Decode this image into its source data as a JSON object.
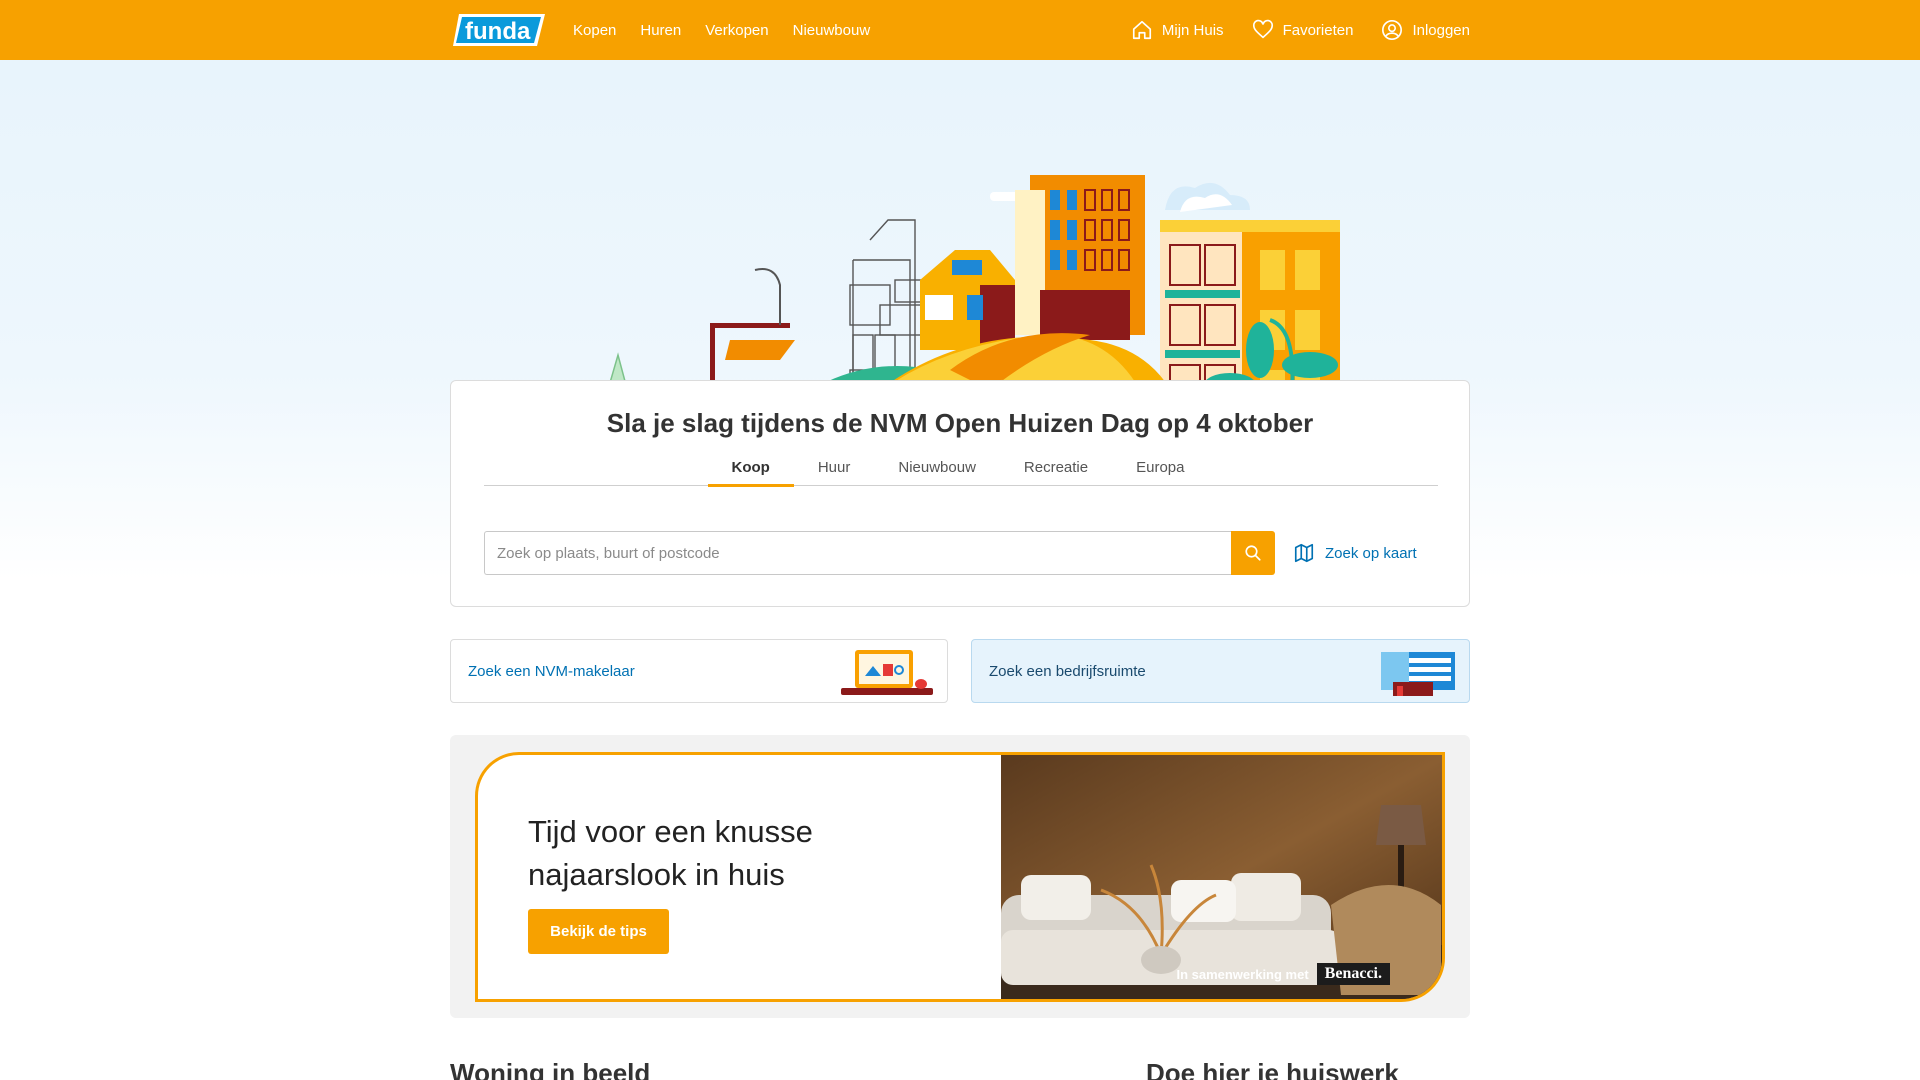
{
  "colors": {
    "brand": "#f7a100",
    "link": "#0071b3",
    "text": "#333333"
  },
  "header": {
    "logo_text": "funda",
    "nav": [
      {
        "label": "Kopen"
      },
      {
        "label": "Huren"
      },
      {
        "label": "Verkopen"
      },
      {
        "label": "Nieuwbouw"
      }
    ],
    "right_nav": [
      {
        "label": "Mijn Huis",
        "icon": "home-icon"
      },
      {
        "label": "Favorieten",
        "icon": "heart-icon"
      },
      {
        "label": "Inloggen",
        "icon": "user-icon"
      }
    ]
  },
  "search": {
    "title": "Sla je slag tijdens de NVM Open Huizen Dag op 4 oktober",
    "tabs": [
      {
        "label": "Koop",
        "active": true
      },
      {
        "label": "Huur",
        "active": false
      },
      {
        "label": "Nieuwbouw",
        "active": false
      },
      {
        "label": "Recreatie",
        "active": false
      },
      {
        "label": "Europa",
        "active": false
      }
    ],
    "placeholder": "Zoek op plaats, buurt of postcode",
    "map_link": "Zoek op kaart"
  },
  "cards": {
    "makelaar": "Zoek een NVM-makelaar",
    "bedrijf": "Zoek een bedrijfsruimte"
  },
  "promo": {
    "title": "Tijd voor een knusse najaarslook in huis",
    "button": "Bekijk de tips",
    "credit_prefix": "In samenwerking met",
    "credit_brand": "Benacci."
  },
  "sections": {
    "left_heading": "Woning in beeld",
    "right_heading": "Doe hier je huiswerk"
  }
}
